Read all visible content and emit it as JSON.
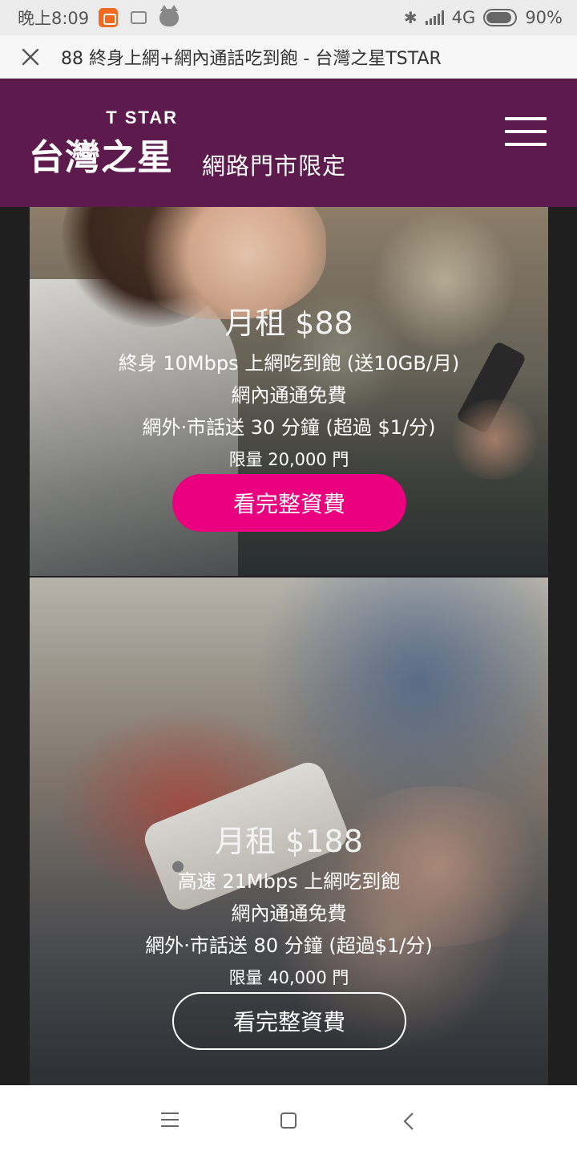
{
  "status_bar": {
    "time": "晚上8:09",
    "network": "4G",
    "battery": "90%"
  },
  "browser": {
    "page_title": "88 終身上網+網內通話吃到飽 - 台灣之星TSTAR"
  },
  "header": {
    "logo_latin": "T STAR",
    "logo_chinese": "台灣之星",
    "subtitle": "網路門市限定"
  },
  "plans": [
    {
      "price": "月租 $88",
      "line1": "終身 10Mbps 上網吃到飽 (送10GB/月)",
      "line2": "網內通通免費",
      "line3": "網外·市話送 30 分鐘 (超過 $1/分)",
      "limit": "限量 20,000 門",
      "button": "看完整資費"
    },
    {
      "price": "月租 $188",
      "line1": "高速 21Mbps 上網吃到飽",
      "line2": "網內通通免費",
      "line3": "網外·市話送 80 分鐘 (超過$1/分)",
      "limit": "限量 40,000 門",
      "button": "看完整資費"
    }
  ],
  "colors": {
    "header_bg": "#5c1a4d",
    "accent": "#ea007f"
  }
}
